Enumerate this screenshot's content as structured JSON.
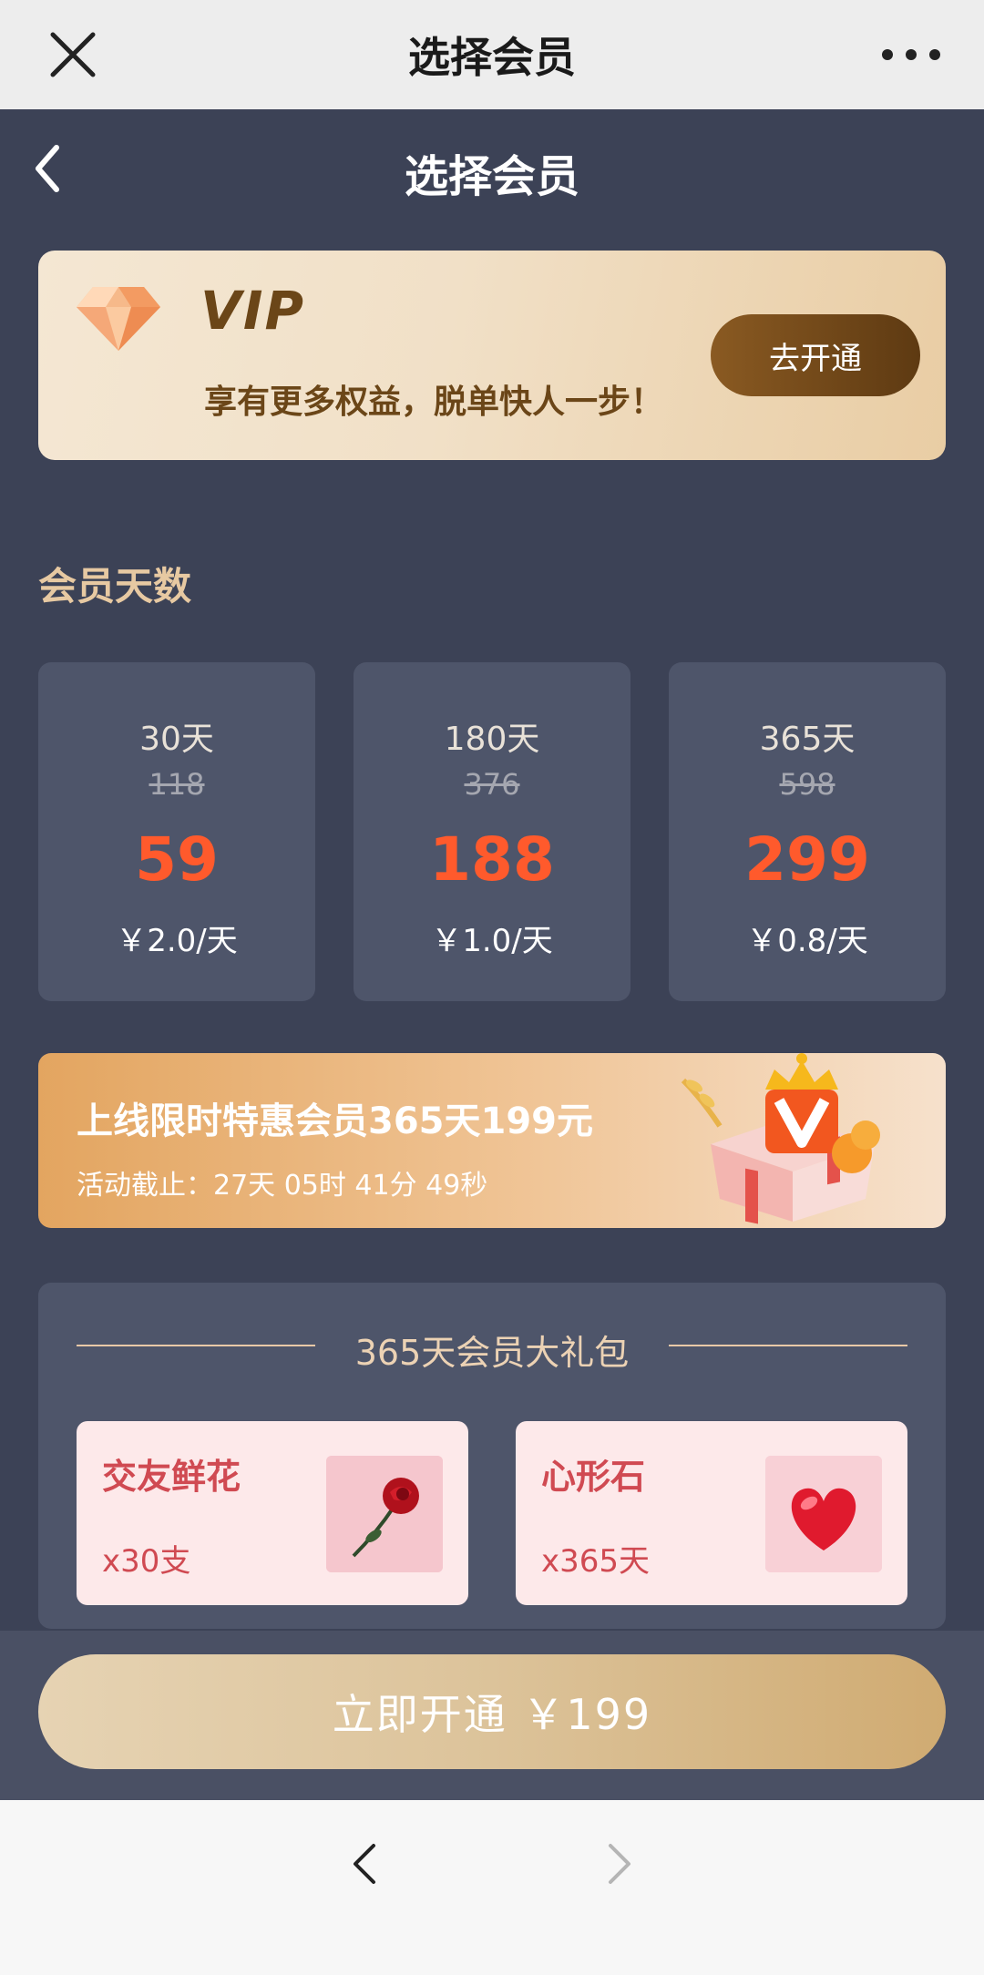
{
  "browser": {
    "title": "选择会员"
  },
  "header": {
    "title": "选择会员"
  },
  "vip_banner": {
    "logo": "VIP",
    "slogan": "享有更多权益，脱单快人一步！",
    "button": "去开通"
  },
  "section_label": "会员天数",
  "plans": [
    {
      "days": "30天",
      "original": "118",
      "price": "59",
      "per_day": "￥2.0/天"
    },
    {
      "days": "180天",
      "original": "376",
      "price": "188",
      "per_day": "￥1.0/天"
    },
    {
      "days": "365天",
      "original": "598",
      "price": "299",
      "per_day": "￥0.8/天"
    }
  ],
  "promo": {
    "title": "上线限时特惠会员365天199元",
    "countdown": "活动截止：27天 05时 41分 49秒"
  },
  "package": {
    "title": "365天会员大礼包",
    "items": [
      {
        "name": "交友鲜花",
        "qty": "x30支",
        "icon": "rose-icon"
      },
      {
        "name": "心形石",
        "qty": "x365天",
        "icon": "heart-stone-icon"
      }
    ]
  },
  "action": {
    "button": "立即开通 ￥199"
  },
  "colors": {
    "bg": "#3c4256",
    "price": "#ff5a2c",
    "gold": "#e7c9a2"
  }
}
